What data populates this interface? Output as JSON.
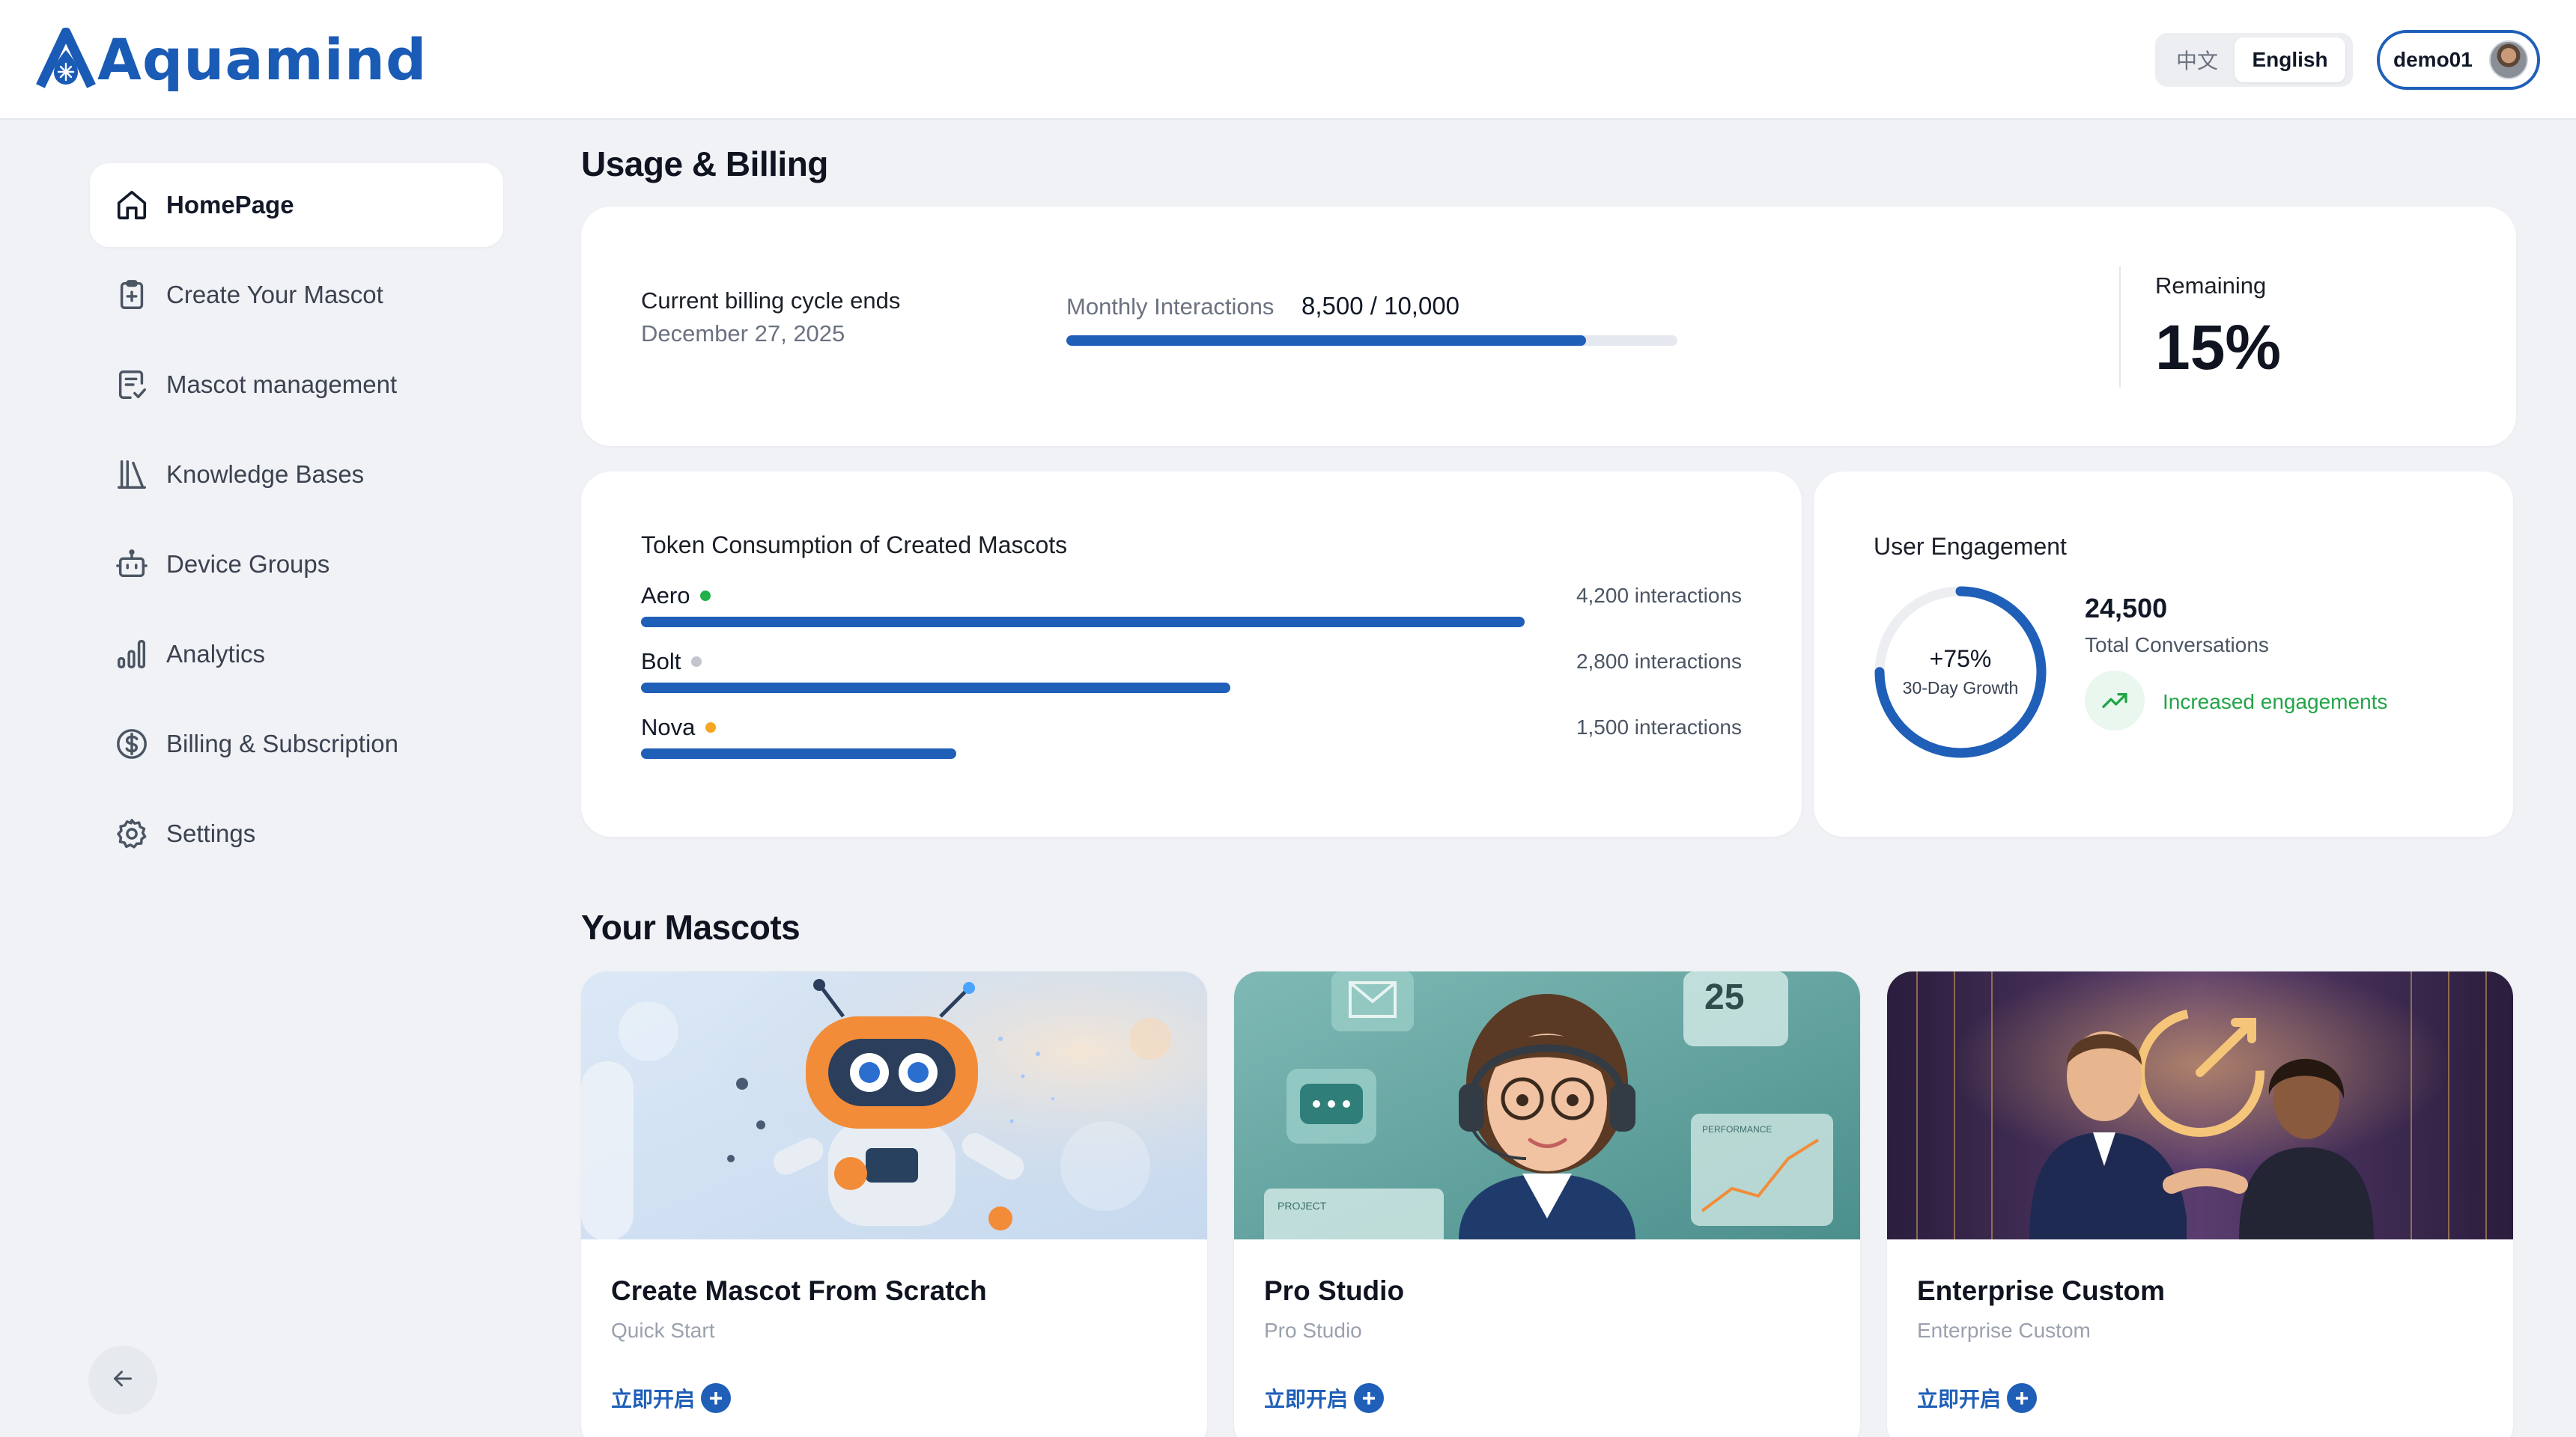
{
  "header": {
    "logo_text": "Aquamind",
    "lang": {
      "zh": "中文",
      "en": "English",
      "active": "en"
    },
    "user": {
      "name": "demo01"
    }
  },
  "sidebar": {
    "items": [
      {
        "label": "HomePage",
        "icon": "home-icon",
        "active": true
      },
      {
        "label": "Create Your Mascot",
        "icon": "clipboard-plus-icon",
        "active": false
      },
      {
        "label": "Mascot management",
        "icon": "checklist-icon",
        "active": false
      },
      {
        "label": "Knowledge Bases",
        "icon": "library-icon",
        "active": false
      },
      {
        "label": "Device Groups",
        "icon": "robot-icon",
        "active": false
      },
      {
        "label": "Analytics",
        "icon": "bar-chart-icon",
        "active": false
      },
      {
        "label": "Billing & Subscription",
        "icon": "dollar-circle-icon",
        "active": false
      },
      {
        "label": "Settings",
        "icon": "gear-icon",
        "active": false
      }
    ],
    "collapse_icon": "arrow-left-icon"
  },
  "usage": {
    "title": "Usage & Billing",
    "cycle_label": "Current billing cycle ends",
    "cycle_date": "December 27, 2025",
    "monthly_label": "Monthly Interactions",
    "monthly_value": "8,500 / 10,000",
    "monthly_used": 8500,
    "monthly_limit": 10000,
    "remaining_label": "Remaining",
    "remaining_value": "15%"
  },
  "tokens": {
    "title": "Token Consumption of Created Mascots",
    "mascots": [
      {
        "name": "Aero",
        "count_label": "4,200 interactions",
        "value": 4200,
        "dot_color": "#22b04b"
      },
      {
        "name": "Bolt",
        "count_label": "2,800 interactions",
        "value": 2800,
        "dot_color": "#c2c6cc"
      },
      {
        "name": "Nova",
        "count_label": "1,500 interactions",
        "value": 1500,
        "dot_color": "#f5a623"
      }
    ]
  },
  "engagement": {
    "title": "User Engagement",
    "growth": "+75%",
    "growth_fraction": 0.75,
    "growth_label": "30-Day Growth",
    "total": "24,500",
    "total_label": "Total Conversations",
    "trend_text": "Increased engagements",
    "trend_icon": "trending-up-icon"
  },
  "mascots": {
    "title": "Your Mascots",
    "cards": [
      {
        "title": "Create Mascot From Scratch",
        "subtitle": "Quick Start",
        "cta": "立即开启",
        "image": "robot-mascot-illustration"
      },
      {
        "title": "Pro Studio",
        "subtitle": "Pro Studio",
        "cta": "立即开启",
        "image": "support-agent-illustration",
        "image_texts": [
          "25",
          "PERFORMANCE",
          "PROJECT"
        ]
      },
      {
        "title": "Enterprise Custom",
        "subtitle": "Enterprise Custom",
        "cta": "立即开启",
        "image": "business-handshake-illustration"
      }
    ]
  },
  "colors": {
    "brand": "#1a5bb5",
    "accent": "#1f5fb8",
    "success": "#22a447",
    "background": "#f0f2f6"
  }
}
